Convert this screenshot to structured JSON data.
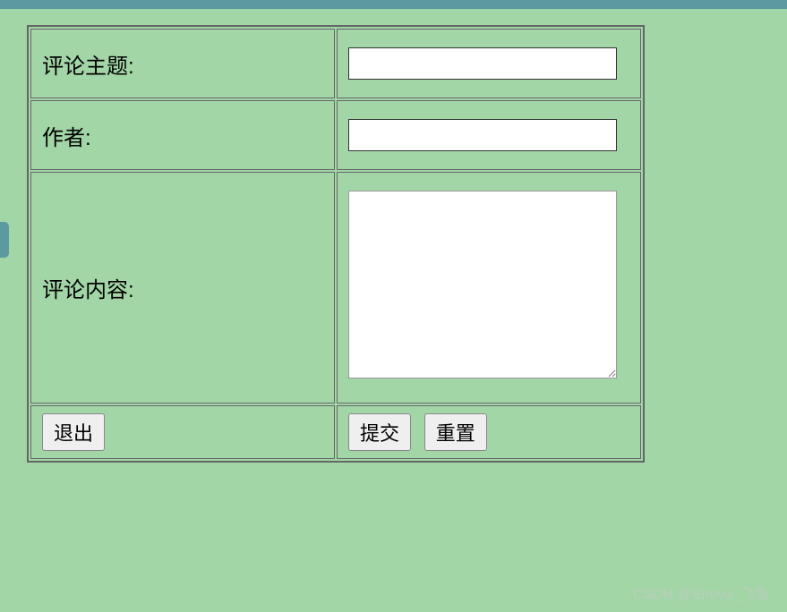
{
  "form": {
    "rows": [
      {
        "label": "评论主题:",
        "value": ""
      },
      {
        "label": "作者:",
        "value": ""
      },
      {
        "label": "评论内容:",
        "value": ""
      }
    ],
    "buttons": {
      "exit": "退出",
      "submit": "提交",
      "reset": "重置"
    }
  },
  "watermark": "CSDN @Enovo_飞鱼"
}
